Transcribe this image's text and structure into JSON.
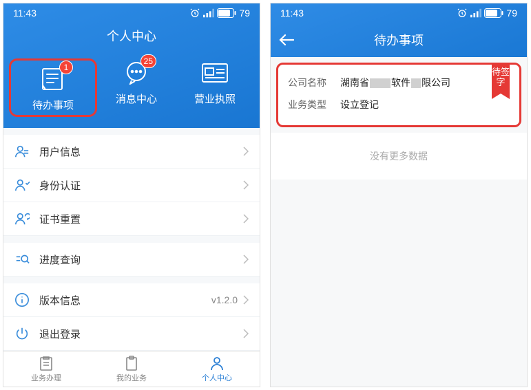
{
  "status": {
    "time": "11:43",
    "battery": "79"
  },
  "screen1": {
    "heroTitle": "个人中心",
    "tiles": [
      {
        "label": "待办事项",
        "badge": "1"
      },
      {
        "label": "消息中心",
        "badge": "25"
      },
      {
        "label": "营业执照"
      }
    ],
    "rows": {
      "userInfo": "用户信息",
      "identity": "身份认证",
      "certReset": "证书重置",
      "progress": "进度查询",
      "version": "版本信息",
      "versionVal": "v1.2.0",
      "logout": "退出登录"
    },
    "tabs": {
      "biz": "业务办理",
      "mine": "我的业务",
      "me": "个人中心"
    }
  },
  "screen2": {
    "title": "待办事项",
    "company": {
      "key": "公司名称",
      "valPrefix": "湖南省",
      "valMid": "软件",
      "valSuffix": "限公司"
    },
    "bizType": {
      "key": "业务类型",
      "val": "设立登记"
    },
    "ribbon": "待签字",
    "empty": "没有更多数据"
  }
}
